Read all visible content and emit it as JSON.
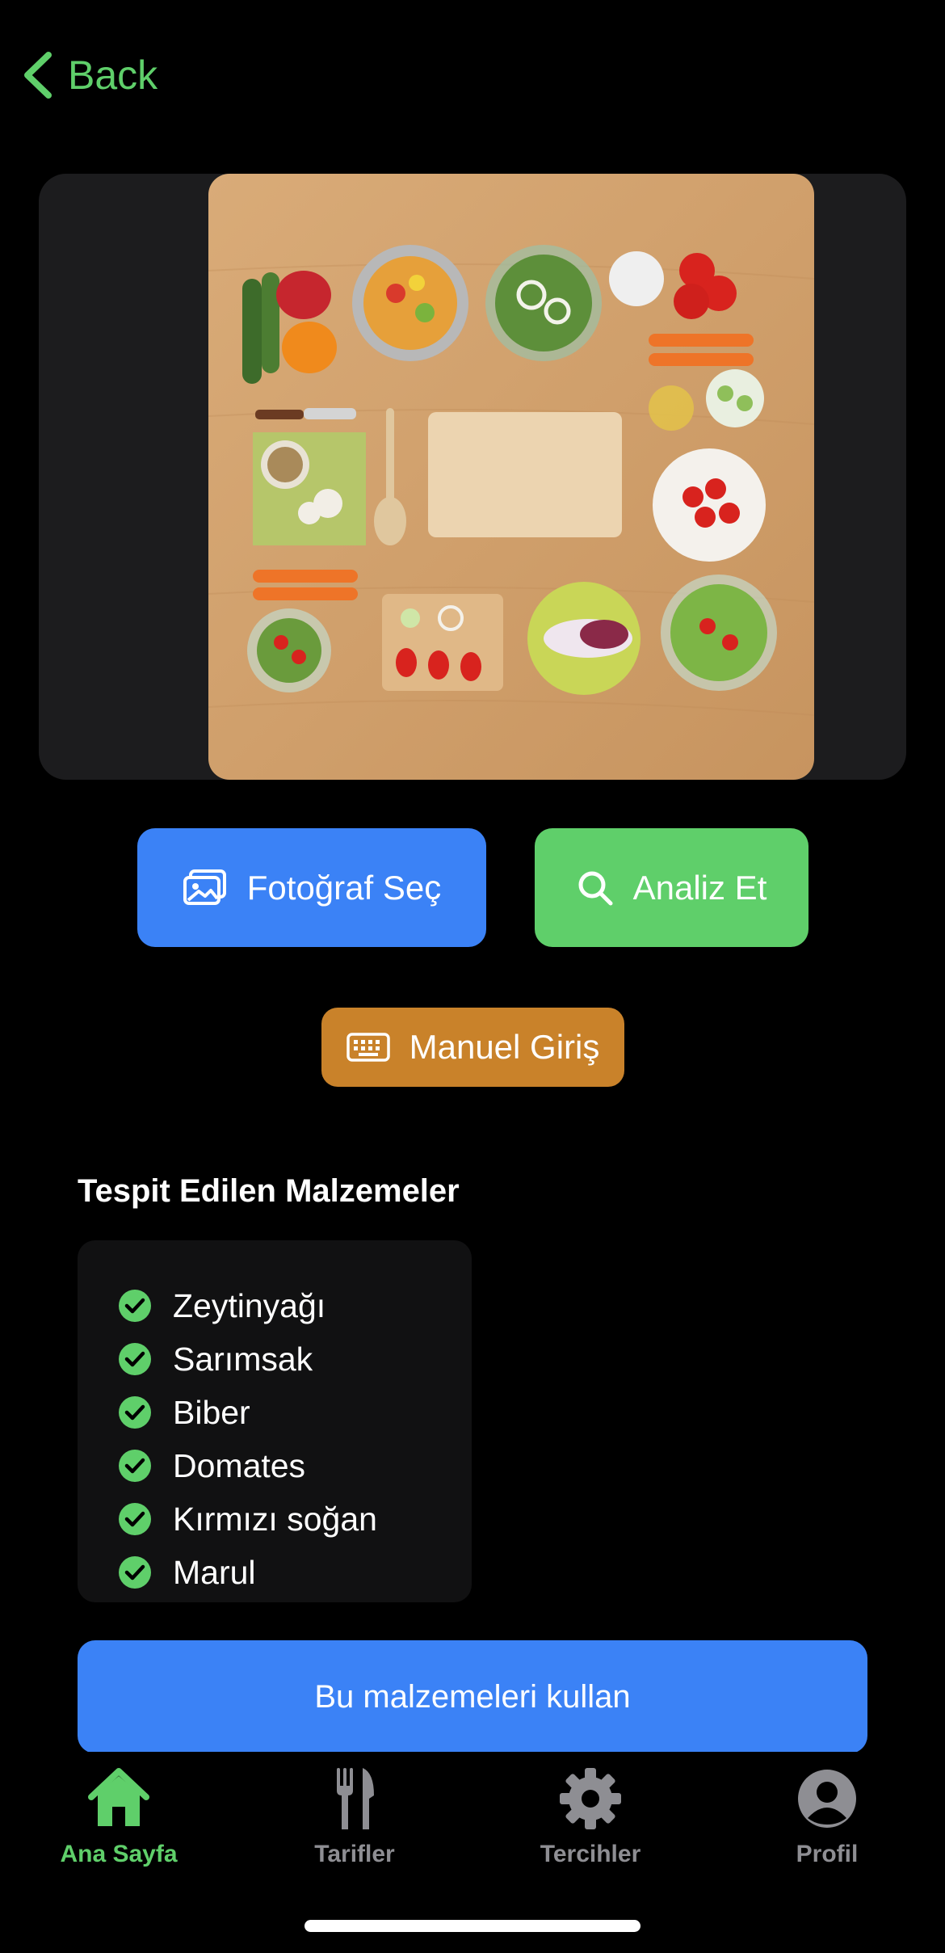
{
  "nav": {
    "back_label": "Back"
  },
  "actions": {
    "photo_label": "Fotoğraf Seç",
    "analyze_label": "Analiz Et",
    "manual_label": "Manuel Giriş",
    "use_label": "Bu malzemeleri kullan"
  },
  "ingredients": {
    "title": "Tespit Edilen Malzemeler",
    "items": [
      "Zeytinyağı",
      "Sarımsak",
      "Biber",
      "Domates",
      "Kırmızı soğan",
      "Marul"
    ]
  },
  "tabs": [
    {
      "label": "Ana Sayfa",
      "icon": "home-icon",
      "active": true
    },
    {
      "label": "Tarifler",
      "icon": "fork-knife-icon",
      "active": false
    },
    {
      "label": "Tercihler",
      "icon": "gear-icon",
      "active": false
    },
    {
      "label": "Profil",
      "icon": "person-icon",
      "active": false
    }
  ],
  "colors": {
    "accent_green": "#5fcf6a",
    "primary_blue": "#3b82f6",
    "manual_orange": "#c9822a",
    "inactive_gray": "#8e8e93"
  }
}
